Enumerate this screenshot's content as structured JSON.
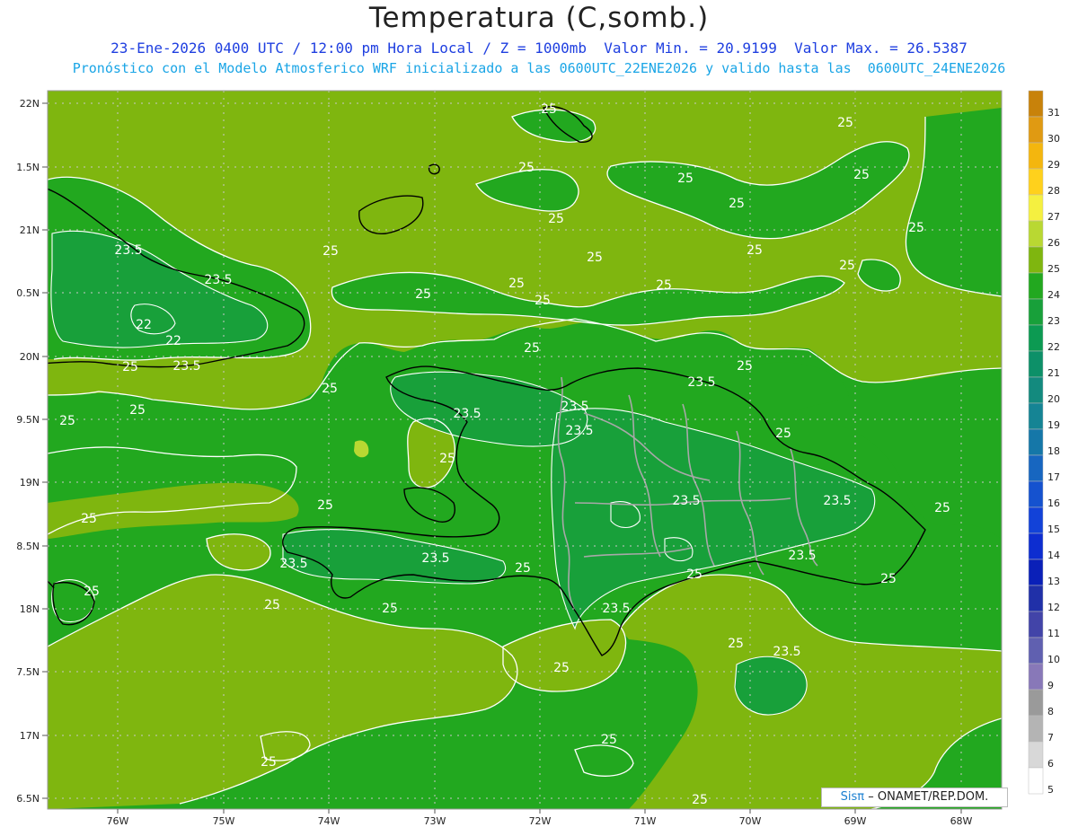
{
  "title": "Temperatura (C,somb.)",
  "subtitle_1": "23-Ene-2026 0400 UTC / 12:00 pm Hora Local / Z = 1000mb  Valor Min. = 20.9199  Valor Max. = 26.5387",
  "subtitle_2": "Pronóstico con el Modelo Atmosferico WRF inicializado a las 0600UTC_22ENE2026 y valido hasta las  0600UTC_24ENE2026",
  "y_ticks": [
    "22N",
    "1.5N",
    "21N",
    "0.5N",
    "20N",
    "9.5N",
    "19N",
    "8.5N",
    "18N",
    "7.5N",
    "17N",
    "6.5N"
  ],
  "x_ticks": [
    "76W",
    "75W",
    "74W",
    "73W",
    "72W",
    "71W",
    "70W",
    "69W",
    "68W"
  ],
  "colorbar": {
    "labels": [
      "31",
      "30",
      "29",
      "28",
      "27",
      "26",
      "25",
      "24",
      "23",
      "22",
      "21",
      "20",
      "19",
      "18",
      "17",
      "16",
      "15",
      "14",
      "13",
      "12",
      "11",
      "10",
      "9",
      "8",
      "7",
      "6",
      "5"
    ],
    "colors": [
      "#c8820a",
      "#e09a12",
      "#f4b60e",
      "#ffd11c",
      "#f5f040",
      "#b9d832",
      "#7fb60f",
      "#22a81f",
      "#18a03a",
      "#0c9a52",
      "#0d9068",
      "#138a7e",
      "#158494",
      "#1577a8",
      "#1766c0",
      "#1552cf",
      "#1242d8",
      "#0d2dd0",
      "#0a20b8",
      "#2030a8",
      "#4244a8",
      "#6060b0",
      "#8878b8",
      "#9a9a9a",
      "#b4b4b4",
      "#d8d8d8",
      "#ffffff"
    ]
  },
  "colors": {
    "band_24_25": "#22a81f",
    "band_25_26": "#7fb60f",
    "band_23_24": "#18a03a",
    "band_26_27": "#b9d832",
    "contour": "#ffffff",
    "coast": "#000000",
    "borders": "#a8a8a8"
  },
  "contour_labels": [
    {
      "text": "25"
    },
    {
      "text": "25"
    },
    {
      "text": "25"
    },
    {
      "text": "25"
    },
    {
      "text": "25"
    },
    {
      "text": "25"
    },
    {
      "text": "25"
    },
    {
      "text": "25"
    },
    {
      "text": "25"
    },
    {
      "text": "25"
    },
    {
      "text": "25"
    },
    {
      "text": "25"
    },
    {
      "text": "25"
    },
    {
      "text": "25"
    },
    {
      "text": "25"
    },
    {
      "text": "25"
    },
    {
      "text": "25"
    },
    {
      "text": "25"
    },
    {
      "text": "25"
    },
    {
      "text": "25"
    },
    {
      "text": "25"
    },
    {
      "text": "25"
    },
    {
      "text": "25"
    },
    {
      "text": "25"
    },
    {
      "text": "25"
    },
    {
      "text": "25"
    },
    {
      "text": "25"
    },
    {
      "text": "25"
    },
    {
      "text": "25"
    },
    {
      "text": "25"
    },
    {
      "text": "25"
    },
    {
      "text": "25"
    },
    {
      "text": "25"
    },
    {
      "text": "25"
    },
    {
      "text": "25"
    },
    {
      "text": "25"
    },
    {
      "text": "25"
    },
    {
      "text": "25"
    },
    {
      "text": "23.5"
    },
    {
      "text": "23.5"
    },
    {
      "text": "23.5"
    },
    {
      "text": "23.5"
    },
    {
      "text": "23.5"
    },
    {
      "text": "23.5"
    },
    {
      "text": "23.5"
    },
    {
      "text": "23.5"
    },
    {
      "text": "23.5"
    },
    {
      "text": "23.5"
    },
    {
      "text": "23.5"
    },
    {
      "text": "23.5"
    },
    {
      "text": "23.5"
    },
    {
      "text": "23.5"
    },
    {
      "text": "22"
    },
    {
      "text": "22"
    }
  ],
  "credit": {
    "brand": "Sisπ",
    "text": "– ONAMET/REP.DOM."
  }
}
